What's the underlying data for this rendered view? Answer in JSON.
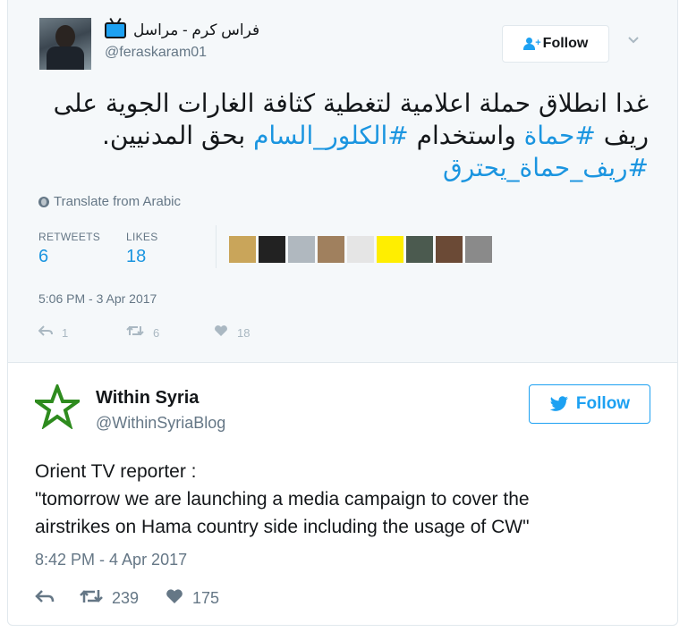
{
  "quoted_tweet": {
    "author_name": "فراس كرم - مراسل",
    "author_handle": "@feraskaram01",
    "follow_label": "Follow",
    "text_part1": "غدا انطلاق حملة اعلامية لتغطية كثافة الغارات الجوية على ريف ",
    "hashtag1": "#حماة",
    "text_part2": " واستخدام ",
    "hashtag2": "#الكلور_السام",
    "text_part3": " بحق المدنيين.",
    "hashtag3": "#ريف_حماة_يحترق",
    "translate_label": "Translate from Arabic",
    "retweets_label": "RETWEETS",
    "retweets_count": "6",
    "likes_label": "LIKES",
    "likes_count": "18",
    "timestamp": "5:06 PM - 3 Apr 2017",
    "reply_count": "1",
    "retweet_action_count": "6",
    "like_action_count": "18",
    "liker_avatar_colors": [
      "#c9a55a",
      "#222222",
      "#b0b8bf",
      "#a0805e",
      "#e5e5e5",
      "#ffee00",
      "#4b5a4f",
      "#6b4a36",
      "#8a8a8a"
    ]
  },
  "main_tweet": {
    "author_name": "Within Syria",
    "author_handle": "@WithinSyriaBlog",
    "follow_label": "Follow",
    "line1": "Orient TV reporter :",
    "line2": "\"tomorrow we are launching a media campaign to cover the",
    "line3": "airstrikes on Hama country side including the usage of CW\"",
    "timestamp": "8:42 PM - 4 Apr 2017",
    "retweet_count": "239",
    "like_count": "175"
  },
  "colors": {
    "twitter_blue": "#1da1f2",
    "link_blue": "#1b95e0",
    "star_green": "#2e8b1e",
    "muted_gray": "#657786"
  }
}
